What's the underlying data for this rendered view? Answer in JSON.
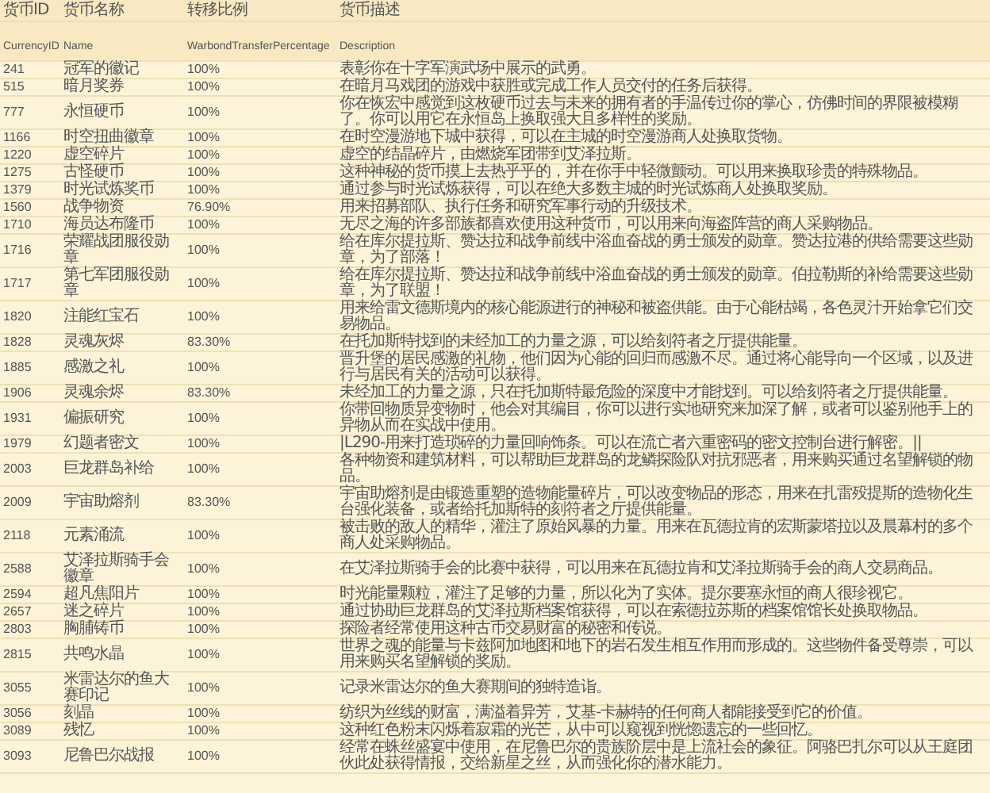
{
  "table": {
    "columns": [
      {
        "title": "货币ID",
        "field": "CurrencyID"
      },
      {
        "title": "货币名称",
        "field": "Name"
      },
      {
        "title": "转移比例",
        "field": "WarbondTransferPercentage"
      },
      {
        "title": "货币描述",
        "field": "Description"
      }
    ],
    "rows": [
      {
        "id": "241",
        "name": "冠军的徽记",
        "percentage": "100%",
        "description": "表彰你在十字军演武场中展示的武勇。"
      },
      {
        "id": "515",
        "name": "暗月奖券",
        "percentage": "100%",
        "description": "在暗月马戏团的游戏中获胜或完成工作人员交付的任务后获得。"
      },
      {
        "id": "777",
        "name": "永恒硬币",
        "percentage": "100%",
        "description": "你在恢宏中感觉到这枚硬币过去与未来的拥有者的手温传过你的掌心，仿佛时间的界限被模糊了。你可以用它在永恒岛上换取强大且多样性的奖励。"
      },
      {
        "id": "1166",
        "name": "时空扭曲徽章",
        "percentage": "100%",
        "description": "在时空漫游地下城中获得，可以在主城的时空漫游商人处换取货物。"
      },
      {
        "id": "1220",
        "name": "虚空碎片",
        "percentage": "100%",
        "description": "虚空的结晶碎片，由燃烧军团带到艾泽拉斯。"
      },
      {
        "id": "1275",
        "name": "古怪硬币",
        "percentage": "100%",
        "description": "这种神秘的货币摸上去热乎乎的，并在你手中轻微颤动。可以用来换取珍贵的特殊物品。"
      },
      {
        "id": "1379",
        "name": "时光试炼奖币",
        "percentage": "100%",
        "description": "通过参与时光试炼获得，可以在绝大多数主城的时光试炼商人处换取奖励。"
      },
      {
        "id": "1560",
        "name": "战争物资",
        "percentage": "76.90%",
        "description": "用来招募部队、执行任务和研究军事行动的升级技术。"
      },
      {
        "id": "1710",
        "name": "海员达布隆币",
        "percentage": "100%",
        "description": "无尽之海的许多部族都喜欢使用这种货币，可以用来向海盗阵营的商人采购物品。"
      },
      {
        "id": "1716",
        "name": "荣耀战团服役勋章",
        "percentage": "100%",
        "description": "给在库尔提拉斯、赞达拉和战争前线中浴血奋战的勇士颁发的勋章。赞达拉港的供给需要这些勋章，为了部落！"
      },
      {
        "id": "1717",
        "name": "第七军团服役勋章",
        "percentage": "100%",
        "description": "给在库尔提拉斯、赞达拉和战争前线中浴血奋战的勇士颁发的勋章。伯拉勒斯的补给需要这些勋章，为了联盟！"
      },
      {
        "id": "1820",
        "name": "注能红宝石",
        "percentage": "100%",
        "description": "用来给雷文德斯境内的核心能源进行的神秘和被盗供能。由于心能枯竭，各色灵汁开始拿它们交易物品。"
      },
      {
        "id": "1828",
        "name": "灵魂灰烬",
        "percentage": "83.30%",
        "description": "在托加斯特找到的未经加工的力量之源，可以给刻符者之厅提供能量。"
      },
      {
        "id": "1885",
        "name": "感激之礼",
        "percentage": "100%",
        "description": "晋升堡的居民感激的礼物，他们因为心能的回归而感激不尽。通过将心能导向一个区域，以及进行与居民有关的活动可以获得。"
      },
      {
        "id": "1906",
        "name": "灵魂余烬",
        "percentage": "83.30%",
        "description": "未经加工的力量之源，只在托加斯特最危险的深度中才能找到。可以给刻符者之厅提供能量。"
      },
      {
        "id": "1931",
        "name": "偏振研究",
        "percentage": "100%",
        "description": "你带回物质异变物时，他会对其编目，你可以进行实地研究来加深了解，或者可以鉴别他手上的异物从而在实战中使用。"
      },
      {
        "id": "1979",
        "name": "幻题者密文",
        "percentage": "100%",
        "description": "|L290-用来打造琐碎的力量回响饰条。可以在流亡者六重密码的密文控制台进行解密。||"
      },
      {
        "id": "2003",
        "name": "巨龙群岛补给",
        "percentage": "100%",
        "description": "各种物资和建筑材料，可以帮助巨龙群岛的龙鳞探险队对抗邪恶者，用来购买通过名望解锁的物品。"
      },
      {
        "id": "2009",
        "name": "宇宙助熔剂",
        "percentage": "83.30%",
        "description": "宇宙助熔剂是由锻造重塑的造物能量碎片，可以改变物品的形态，用来在扎雷殁提斯的造物化生台强化装备，或者给托加斯特的刻符者之厅提供能量。"
      },
      {
        "id": "2118",
        "name": "元素涌流",
        "percentage": "100%",
        "description": "被击败的敌人的精华，灌注了原始风暴的力量。用来在瓦德拉肯的宏斯蒙塔拉以及晨幕村的多个商人处采购物品。"
      },
      {
        "id": "2588",
        "name": "艾泽拉斯骑手会徽章",
        "percentage": "100%",
        "description": "在艾泽拉斯骑手会的比赛中获得，可以用来在瓦德拉肯和艾泽拉斯骑手会的商人交易商品。"
      },
      {
        "id": "2594",
        "name": "超凡焦阳片",
        "percentage": "100%",
        "description": "时光能量颗粒，灌注了足够的力量，所以化为了实体。提尔要塞永恒的商人很珍视它。"
      },
      {
        "id": "2657",
        "name": "迷之碎片",
        "percentage": "100%",
        "description": "通过协助巨龙群岛的艾泽拉斯档案馆获得，可以在索德拉苏斯的档案馆馆长处换取物品。"
      },
      {
        "id": "2803",
        "name": "胸脯铸币",
        "percentage": "100%",
        "description": "探险者经常使用这种古币交易财富的秘密和传说。"
      },
      {
        "id": "2815",
        "name": "共鸣水晶",
        "percentage": "100%",
        "description": "世界之魂的能量与卡兹阿加地图和地下的岩石发生相互作用而形成的。这些物件备受尊崇，可以用来购买名望解锁的奖励。"
      },
      {
        "id": "3055",
        "name": "米雷达尔的鱼大赛印记",
        "percentage": "100%",
        "description": "记录米雷达尔的鱼大赛期间的独特造诣。"
      },
      {
        "id": "3056",
        "name": "刻晶",
        "percentage": "100%",
        "description": "纺织为丝线的财富，满溢着异芳，艾基-卡赫特的任何商人都能接受到它的价值。"
      },
      {
        "id": "3089",
        "name": "残忆",
        "percentage": "100%",
        "description": "这种红色粉末闪烁着寂霜的光芒，从中可以窥视到恍惚遗忘的一些回忆。"
      },
      {
        "id": "3093",
        "name": "尼鲁巴尔战报",
        "percentage": "100%",
        "description": "经常在蛛丝盛宴中使用，在尼鲁巴尔的贵族阶层中是上流社会的象征。阿骆巴扎尔可以从王庭团伙此处获得情报，交给新星之丝，从而强化你的潜水能力。"
      }
    ]
  }
}
